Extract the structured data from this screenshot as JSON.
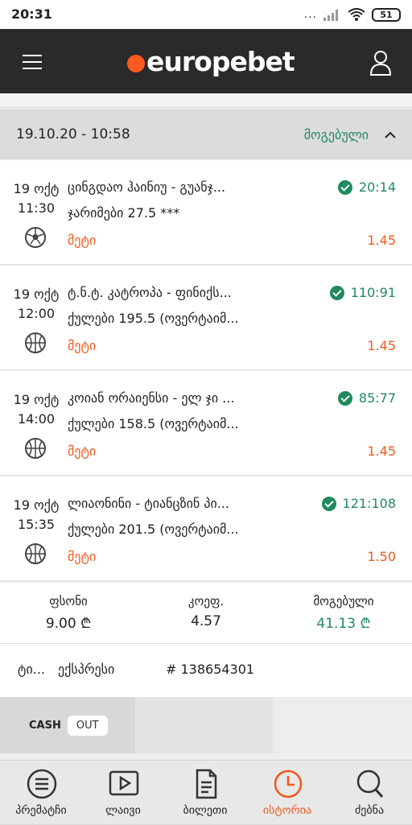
{
  "status_bar": {
    "time": "20:31",
    "dots": "...",
    "battery": "51"
  },
  "header": {
    "logo_text": "europebet",
    "brand_color": "#ff5a1f"
  },
  "ticket": {
    "date": "19.10.20 - 10:58",
    "status": "მოგებული",
    "bets": [
      {
        "date": "19 ოქტ",
        "time": "11:30",
        "teams": "ცინგდაო ჰაინიუ - გუანჯ...",
        "market": "ჯარიმები 27.5 ***",
        "pick": "მეტი",
        "score": "20:14",
        "odds": "1.45",
        "sport_icon": "football-icon"
      },
      {
        "date": "19 ოქტ",
        "time": "12:00",
        "teams": "ტ.ნ.ტ. კატროპა - ფინიქს...",
        "market": "ქულები 195.5 (ოვერტაიმ...",
        "pick": "მეტი",
        "score": "110:91",
        "odds": "1.45",
        "sport_icon": "basketball-icon"
      },
      {
        "date": "19 ოქტ",
        "time": "14:00",
        "teams": "კოიან ორაიენსი - ელ ჯი ...",
        "market": "ქულები 158.5 (ოვერტაიმ...",
        "pick": "მეტი",
        "score": "85:77",
        "odds": "1.45",
        "sport_icon": "basketball-icon"
      },
      {
        "date": "19 ოქტ",
        "time": "15:35",
        "teams": "ლიაონინი - ტიანცზინ პი...",
        "market": "ქულები 201.5 (ოვერტაიმ...",
        "pick": "მეტი",
        "score": "121:108",
        "odds": "1.50",
        "sport_icon": "basketball-icon"
      }
    ],
    "totals": {
      "stake_label": "ფსონი",
      "stake_value": "9.00 ₾",
      "coef_label": "კოეფ.",
      "coef_value": "4.57",
      "win_label": "მოგებული",
      "win_value": "41.13 ₾"
    },
    "type_label": "ტი...",
    "type_value": "ექსპრესი",
    "ticket_id": "# 138654301",
    "cashout": {
      "cash": "CASH",
      "out": "OUT"
    }
  },
  "bottom_nav": [
    {
      "label": "პრემატჩი",
      "icon": "list-icon",
      "active": false
    },
    {
      "label": "ლაივი",
      "icon": "play-icon",
      "active": false
    },
    {
      "label": "ბილეთი",
      "icon": "ticket-icon",
      "active": false
    },
    {
      "label": "ისტორია",
      "icon": "clock-icon",
      "active": true
    },
    {
      "label": "ძებნა",
      "icon": "search-icon",
      "active": false
    }
  ],
  "colors": {
    "green": "#1f8a5b",
    "orange": "#ef5a1d",
    "header_bg": "#2a2a2a"
  }
}
